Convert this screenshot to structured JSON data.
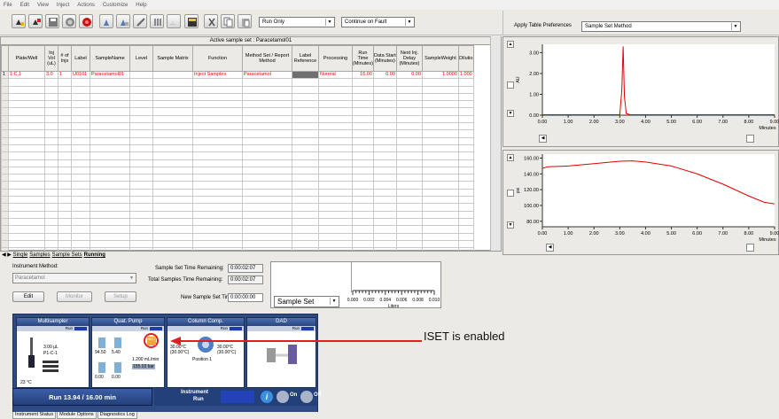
{
  "menu": [
    "File",
    "Edit",
    "View",
    "Inject",
    "Actions",
    "Customize",
    "Help"
  ],
  "toolbar": {
    "run_mode": "Run Only",
    "fault_mode": "Continue on Fault",
    "apply_prefs_label": "Apply Table Preferences",
    "apply_prefs_value": "Sample Set Method"
  },
  "grid": {
    "title": "Active sample set : Paracetamol01",
    "columns": [
      "Plate/Well",
      "Inj Vol (uL)",
      "# of Injs",
      "Label",
      "SampleName",
      "Level",
      "Sample Matrix",
      "Function",
      "Method Set / Report Method",
      "Label Reference",
      "Processing",
      "Run Time (Minutes)",
      "Data Start (Minutes)",
      "Next Inj. Delay (Minutes)",
      "SampleWeight",
      "Dilutio"
    ],
    "rows": [
      [
        "1:C,1",
        "3.0",
        "1",
        "U0101",
        "Paracetamol01",
        "",
        "",
        "Inject Samples",
        "Paracetamol",
        "",
        "Normal",
        "16.00",
        "0.00",
        "0.00",
        "1.0000",
        "1.000"
      ]
    ],
    "row_numbers": [
      "1"
    ]
  },
  "tabs": [
    "Single",
    "Samples",
    "Sample Sets",
    "Running"
  ],
  "controls": {
    "instrument_method_label": "Instrument Method:",
    "instrument_method_value": "Paracetamol",
    "edit_label": "Edit",
    "monitor_label": "Monitor",
    "setup_label": "Setup",
    "sample_set_time_label": "Sample Set Time Remaining:",
    "sample_set_time_value": "0:00:02:07",
    "total_samples_time_label": "Total Samples Time Remaining:",
    "total_samples_time_value": "0:00:02:07",
    "new_sample_set_time_label": "New Sample Set Time:",
    "new_sample_set_time_value": "0:00:00:00",
    "sample_set_dropdown": "Sample Set",
    "liters_axis_ticks": [
      "0.000",
      "0.002",
      "0.004",
      "0.006",
      "0.008",
      "0.010"
    ],
    "liters_label": "Liters"
  },
  "chart_data": [
    {
      "type": "line",
      "ylabel": "AU",
      "xlabel": "Minutes",
      "xlim": [
        0,
        9
      ],
      "ylim": [
        0,
        3.4
      ],
      "x_ticks": [
        "0.00",
        "1.00",
        "2.00",
        "3.00",
        "4.00",
        "5.00",
        "6.00",
        "7.00",
        "8.00",
        "9.00"
      ],
      "y_ticks": [
        "0.00",
        "1.00",
        "2.00",
        "3.00"
      ],
      "series": [
        {
          "x": [
            0,
            3.0,
            3.08,
            3.13,
            3.18,
            3.25,
            3.4,
            9
          ],
          "y": [
            0.02,
            0.02,
            1.2,
            3.3,
            0.9,
            0.08,
            0.02,
            0.02
          ],
          "color": "#e00000"
        }
      ]
    },
    {
      "type": "line",
      "ylabel": "psi",
      "xlabel": "Minutes",
      "xlim": [
        0,
        9
      ],
      "ylim": [
        73,
        165
      ],
      "x_ticks": [
        "0.00",
        "1.00",
        "2.00",
        "3.00",
        "4.00",
        "5.00",
        "6.00",
        "7.00",
        "8.00",
        "9.00"
      ],
      "y_ticks": [
        "80.00",
        "100.00",
        "120.00",
        "140.00",
        "160.00"
      ],
      "series": [
        {
          "x": [
            0,
            0.2,
            1,
            2,
            3,
            3.5,
            4,
            5,
            6,
            7,
            8,
            8.6,
            9
          ],
          "y": [
            147,
            149,
            150,
            153,
            156,
            156.5,
            155,
            150,
            140,
            127,
            112,
            104,
            102
          ],
          "color": "#e00000"
        }
      ]
    }
  ],
  "instrument": {
    "modules": [
      {
        "name": "Multisampler",
        "lines": [
          "3.00 µL",
          "P1-C-1"
        ],
        "temp": "23 °C",
        "status": "Run"
      },
      {
        "name": "Quat. Pump",
        "lines": [
          "94.50",
          "5.40",
          "0.00",
          "0.00"
        ],
        "flow": "1.200 mL/min",
        "pressure": "155.03 bar",
        "status": "Run"
      },
      {
        "name": "Column Comp.",
        "lines": [
          "30.00°C",
          "(30.00°C)",
          "30.00°C",
          "(30.00°C)"
        ],
        "position": "Position 1",
        "status": "Run"
      },
      {
        "name": "DAD",
        "status": "Run"
      }
    ],
    "run_status": "Run 13.94 / 16.00 min",
    "instrument_label": "Instrument",
    "instrument_state": "Run",
    "on_label": "On",
    "off_label": "Off",
    "iset_label": "ISET"
  },
  "bottom_tabs": [
    "Instrument Status",
    "Module Options",
    "Diagnostics Log"
  ],
  "annotation": "ISET is enabled"
}
